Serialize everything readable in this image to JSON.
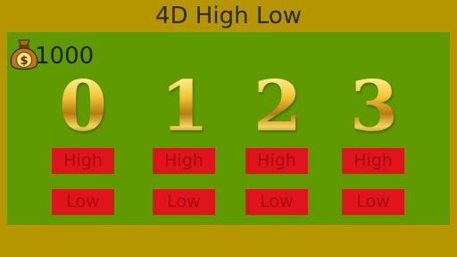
{
  "app": {
    "title": "4D High Low"
  },
  "wallet": {
    "icon": "money-bag-icon",
    "balance": "1000"
  },
  "digits": [
    {
      "value": "0",
      "high_label": "High",
      "low_label": "Low"
    },
    {
      "value": "1",
      "high_label": "High",
      "low_label": "Low"
    },
    {
      "value": "2",
      "high_label": "High",
      "low_label": "Low"
    },
    {
      "value": "3",
      "high_label": "High",
      "low_label": "Low"
    }
  ],
  "colors": {
    "frame": "#b59500",
    "board": "#5f9a00",
    "button": "#e0141c",
    "button_text": "#a60b10",
    "digit_gold": "#d9a520"
  }
}
